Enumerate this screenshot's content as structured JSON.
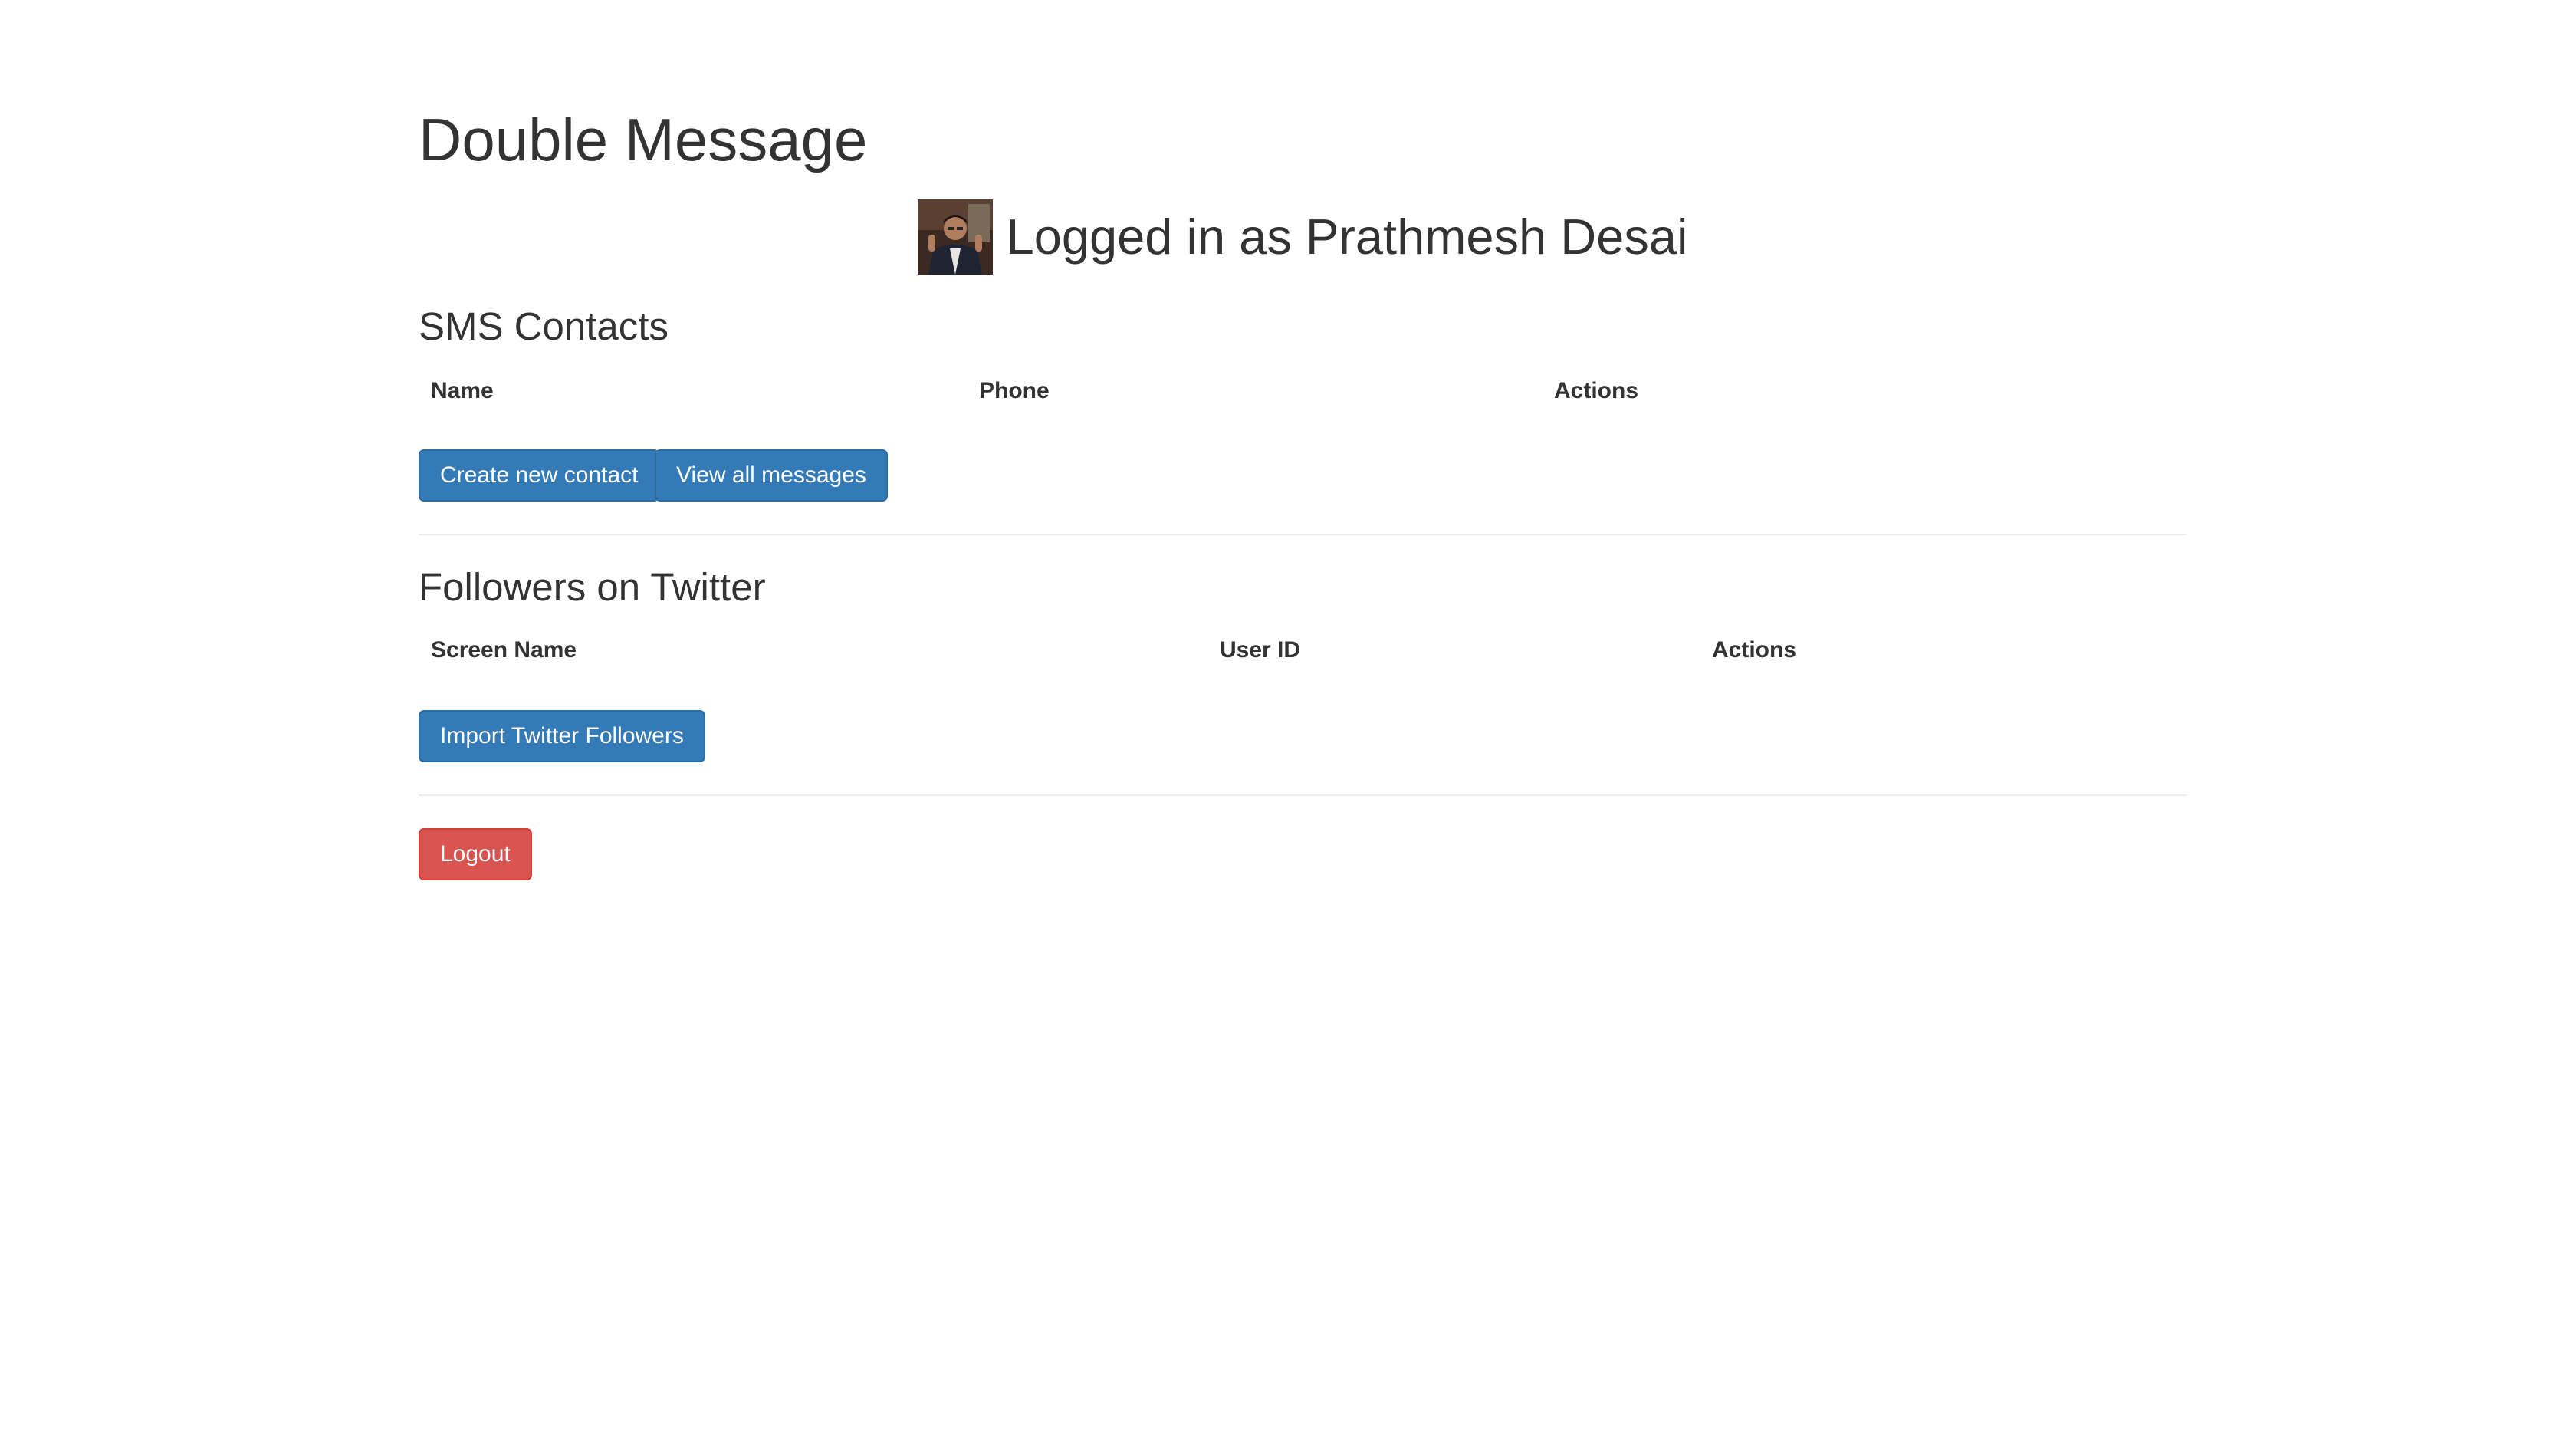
{
  "app": {
    "title": "Double Message"
  },
  "user": {
    "login_text": "Logged in as Prathmesh Desai"
  },
  "sms_section": {
    "title": "SMS Contacts",
    "columns": [
      "Name",
      "Phone",
      "Actions"
    ],
    "rows": [],
    "buttons": {
      "create_contact": "Create new contact",
      "view_messages": "View all messages"
    }
  },
  "twitter_section": {
    "title": "Followers on Twitter",
    "columns": [
      "Screen Name",
      "User ID",
      "Actions"
    ],
    "rows": [],
    "buttons": {
      "import_followers": "Import Twitter Followers"
    }
  },
  "logout": {
    "label": "Logout"
  },
  "colors": {
    "primary": "#337ab7",
    "danger": "#d9534f",
    "text": "#333333",
    "divider": "#eeeeee"
  }
}
